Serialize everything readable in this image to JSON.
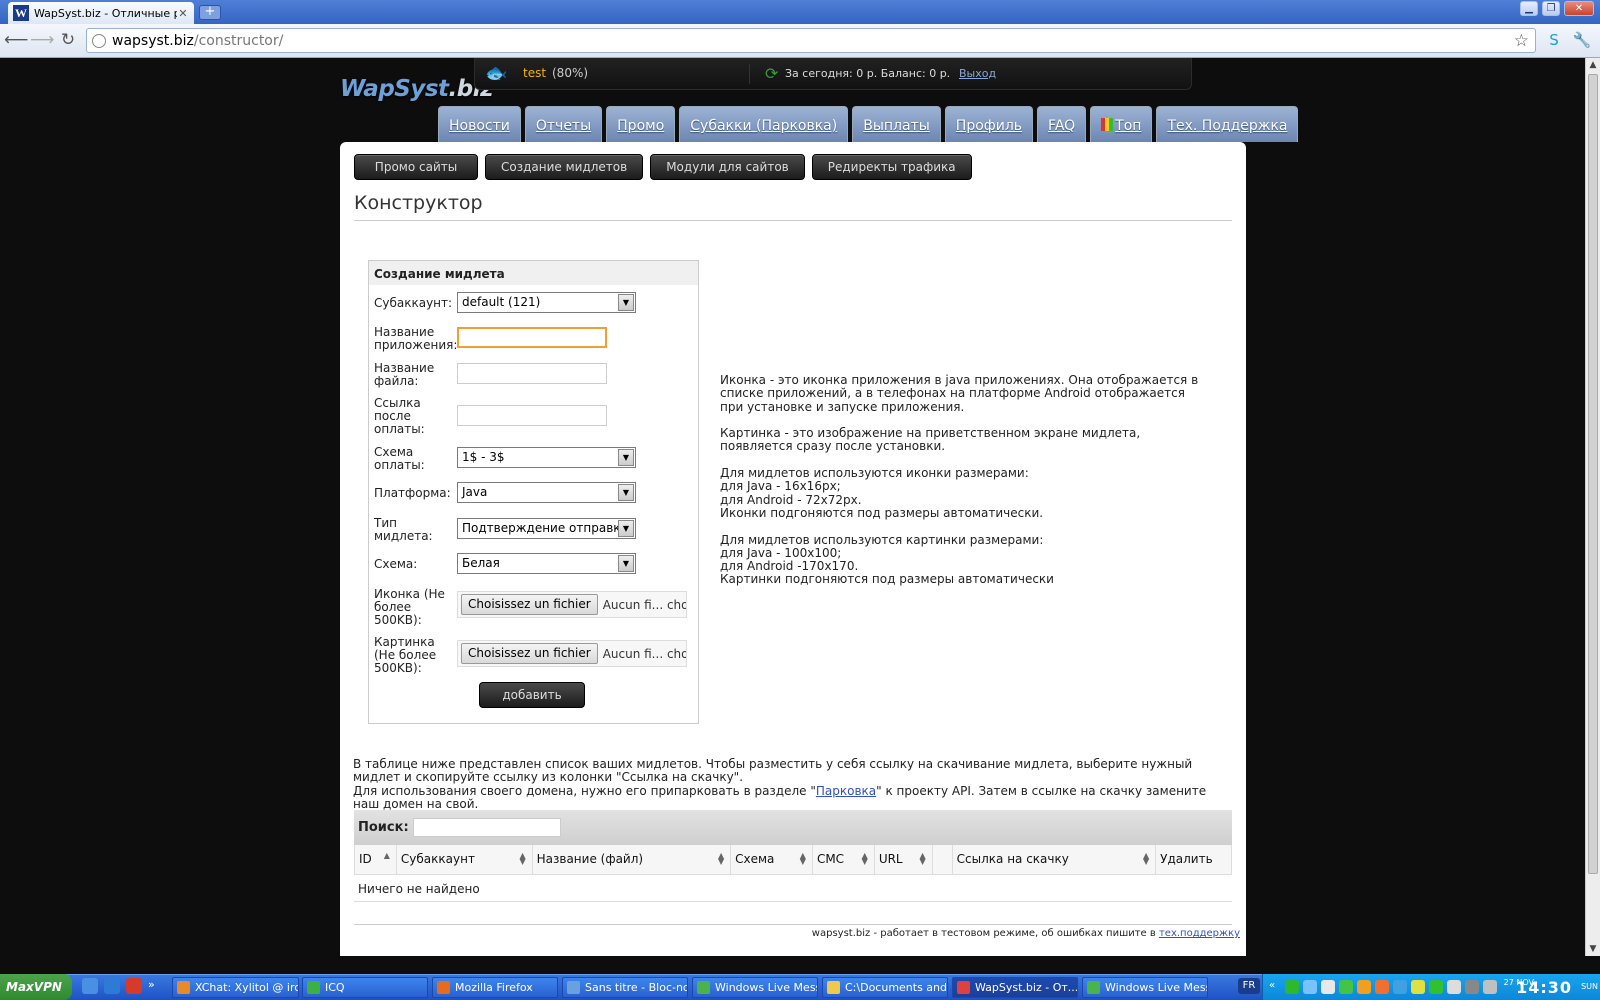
{
  "browser": {
    "tab_title": "WapSyst.biz - Отличные реш",
    "tab_favicon": "W",
    "new_tab": "+",
    "url_domain": "wapsyst.biz",
    "url_path": "/constructor/"
  },
  "site": {
    "logo_main": "WapSyst",
    "logo_suffix": ".biz",
    "user": {
      "name": "test",
      "percent": "(80%)",
      "stats": "За сегодня: 0 р. Баланс: 0 р.",
      "logout": "Выход"
    },
    "main_nav": [
      {
        "label": "Новости"
      },
      {
        "label": "Отчеты"
      },
      {
        "label": "Промо"
      },
      {
        "label": "Субакки (Парковка)"
      },
      {
        "label": "Выплаты"
      },
      {
        "label": "Профиль"
      },
      {
        "label": "FAQ"
      },
      {
        "label": "Топ"
      },
      {
        "label": "Тех. Поддержка"
      }
    ],
    "sub_nav": [
      {
        "label": "Промо сайты"
      },
      {
        "label": "Создание мидлетов"
      },
      {
        "label": "Модули для сайтов"
      },
      {
        "label": "Редиректы трафика"
      }
    ],
    "page_title": "Конструктор"
  },
  "form": {
    "header": "Создание мидлета",
    "subaccount": {
      "label": "Субаккаунт:",
      "value": "default (121)"
    },
    "app_name": {
      "label": "Название приложения:",
      "value": ""
    },
    "file_name": {
      "label": "Название файла:",
      "value": ""
    },
    "after_pay_link": {
      "label": "Ссылка после оплаты:",
      "value": ""
    },
    "pay_scheme": {
      "label": "Схема оплаты:",
      "value": "1$ - 3$"
    },
    "platform": {
      "label": "Платформа:",
      "value": "Java"
    },
    "midlet_type": {
      "label": "Тип мидлета:",
      "value": "Подтверждение отправки"
    },
    "scheme": {
      "label": "Схема:",
      "value": "Белая"
    },
    "icon": {
      "label": "Иконка (Не более 500KB):",
      "button": "Choisissez un fichier",
      "status": "Aucun fi... choisi"
    },
    "picture": {
      "label": "Картинка (Не более 500KB):",
      "button": "Choisissez un fichier",
      "status": "Aucun fi... choisi"
    },
    "submit": "добавить"
  },
  "help": {
    "p1": "Иконка - это иконка приложения в java приложениях. Она отображается в списке приложений, а в телефонах на платформе Android отображается при установке и запуске приложения.",
    "p2": "Картинка - это изображение на приветственном экране мидлета, появляется сразу после установки.",
    "p3_l1": "Для мидлетов используются иконки размерами:",
    "p3_l2": "для Java - 16x16px;",
    "p3_l3": "для Android - 72x72px.",
    "p3_l4": "Иконки подгоняются под размеры автоматически.",
    "p4_l1": "Для мидлетов используются картинки размерами:",
    "p4_l2": "для Java - 100x100;",
    "p4_l3": "для Android -170x170.",
    "p4_l4": "Картинки подгоняются под размеры автоматически"
  },
  "note": {
    "line1": "В таблице ниже представлен список ваших мидлетов. Чтобы разместить у себя ссылку на скачивание мидлета, выберите нужный мидлет и скопируйте ссылку из колонки \"Ссылка на скачку\".",
    "line2_pre": "Для использования своего домена, нужно его припарковать в разделе \"",
    "line2_link": "Парковка",
    "line2_post": "\" к проекту API. Затем в ссылке на скачку замените наш домен на свой."
  },
  "table": {
    "search_label": "Поиск:",
    "search_value": "",
    "columns": [
      "ID",
      "Субаккаунт",
      "Название (файл)",
      "Схема",
      "СМС",
      "URL",
      "",
      "Ссылка на скачку",
      "Удалить"
    ],
    "empty_text": "Ничего не найдено"
  },
  "footer": {
    "text": "wapsyst.biz - работает в тестовом режиме, об ошибках пишите в ",
    "link": "тех.поддержку"
  },
  "taskbar": {
    "start": "MaxVPN",
    "items": [
      {
        "label": "XChat: Xylitol @ irc....",
        "icon_color": "#e88a2a"
      },
      {
        "label": "ICQ",
        "icon_color": "#3cb043"
      },
      {
        "label": "Mozilla Firefox",
        "icon_color": "#e66b1e"
      },
      {
        "label": "Sans titre - Bloc-notes",
        "icon_color": "#6aa0e0"
      },
      {
        "label": "Windows Live Mess...",
        "icon_color": "#4bb34b"
      },
      {
        "label": "C:\\Documents and ...",
        "icon_color": "#f0c850"
      },
      {
        "label": "WapSyst.biz - От...",
        "icon_color": "#e04040"
      },
      {
        "label": "Windows Live Mess...",
        "icon_color": "#4bb34b"
      }
    ],
    "lang": "FR",
    "clock": "14:30",
    "date": "27 NOV",
    "day": "SUN"
  },
  "colors": {
    "accent_nav": "#7a94bf",
    "user_name": "#f3b300",
    "page_bg": "#0d0d0d",
    "taskbar": "#245edc"
  }
}
